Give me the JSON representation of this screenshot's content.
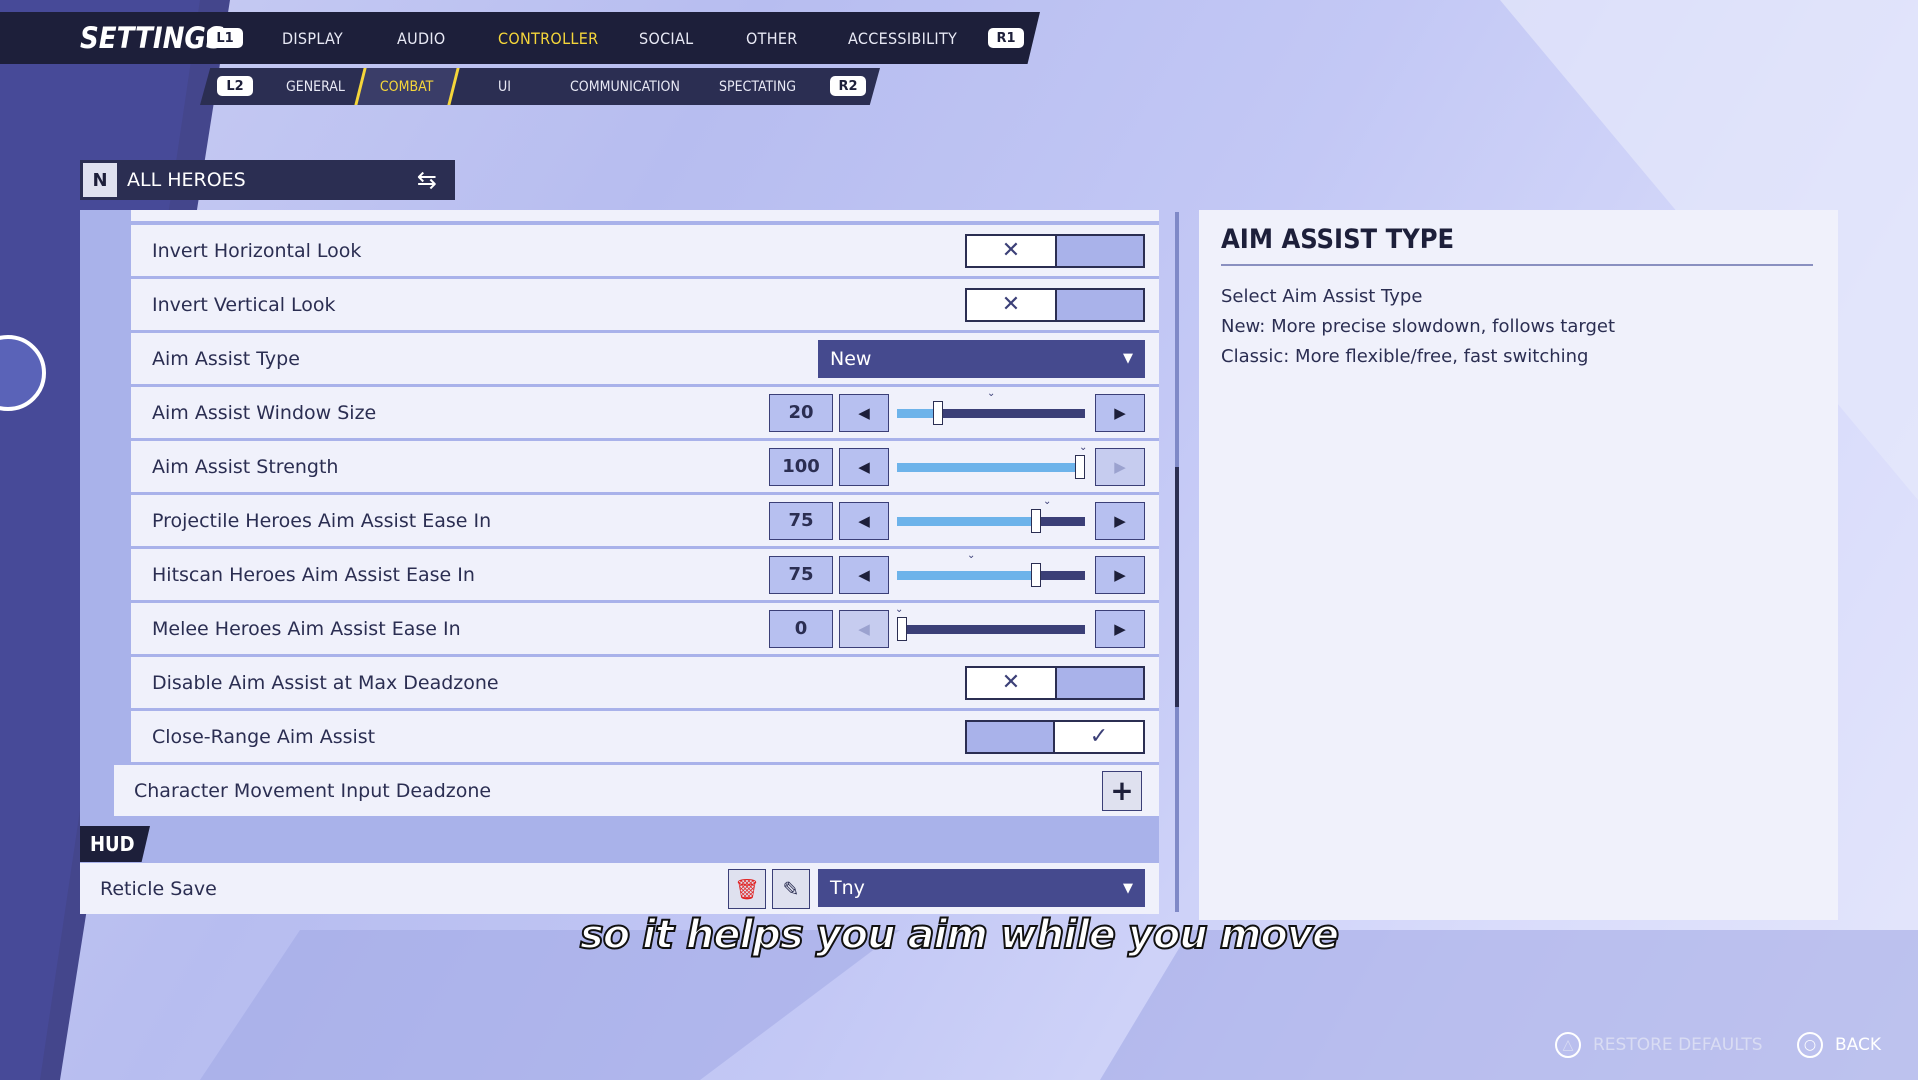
{
  "top_nav": {
    "title": "SETTINGS",
    "left_badge": "L1",
    "right_badge": "R1",
    "tabs": [
      {
        "label": "DISPLAY",
        "active": false
      },
      {
        "label": "AUDIO",
        "active": false
      },
      {
        "label": "CONTROLLER",
        "active": true
      },
      {
        "label": "SOCIAL",
        "active": false
      },
      {
        "label": "OTHER",
        "active": false
      },
      {
        "label": "ACCESSIBILITY",
        "active": false
      }
    ]
  },
  "sub_nav": {
    "left_badge": "L2",
    "right_badge": "R2",
    "tabs": [
      {
        "label": "GENERAL",
        "active": false
      },
      {
        "label": "COMBAT",
        "active": true
      },
      {
        "label": "UI",
        "active": false
      },
      {
        "label": "COMMUNICATION",
        "active": false
      },
      {
        "label": "SPECTATING",
        "active": false
      }
    ]
  },
  "hero_selector": {
    "label": "ALL HEROES"
  },
  "settings": {
    "invert_horizontal": {
      "label": "Invert Horizontal Look",
      "value": false
    },
    "invert_vertical": {
      "label": "Invert Vertical Look",
      "value": false
    },
    "aim_assist_type": {
      "label": "Aim Assist Type",
      "value": "New"
    },
    "aim_window_size": {
      "label": "Aim Assist Window Size",
      "value": "20",
      "fraction": 0.2
    },
    "aim_strength": {
      "label": "Aim Assist Strength",
      "value": "100",
      "fraction": 1.0
    },
    "projectile_ease": {
      "label": "Projectile Heroes Aim Assist Ease In",
      "value": "75",
      "fraction": 0.75
    },
    "hitscan_ease": {
      "label": "Hitscan Heroes Aim Assist Ease In",
      "value": "75",
      "fraction": 0.75
    },
    "melee_ease": {
      "label": "Melee Heroes Aim Assist Ease In",
      "value": "0",
      "fraction": 0.0
    },
    "disable_max_deadzone": {
      "label": "Disable Aim Assist at Max Deadzone",
      "value": false
    },
    "close_range": {
      "label": "Close-Range Aim Assist",
      "value": true
    },
    "movement_deadzone": {
      "label": "Character Movement Input Deadzone"
    }
  },
  "hud": {
    "section_label": "HUD",
    "reticle_save": {
      "label": "Reticle Save",
      "value": "Tny"
    }
  },
  "info_panel": {
    "title": "AIM ASSIST TYPE",
    "lines": [
      "Select Aim Assist Type",
      "New: More precise slowdown, follows target",
      "Classic: More flexible/free, fast switching"
    ]
  },
  "subtitle": "so it helps you aim while you move",
  "footer": {
    "restore_defaults": "RESTORE DEFAULTS",
    "back": "BACK"
  },
  "icons": {
    "swap": "swap-icon",
    "trash": "trash-icon",
    "edit": "edit-icon",
    "plus": "plus-icon",
    "triangle": "triangle-button-icon",
    "circle": "circle-button-icon"
  },
  "colors": {
    "accent_active": "#f5d63a",
    "nav_bg": "#1d1f3a",
    "slider_fill": "#6db3ea",
    "dropdown_bg": "#454a8e",
    "trash_red": "#e02424"
  }
}
